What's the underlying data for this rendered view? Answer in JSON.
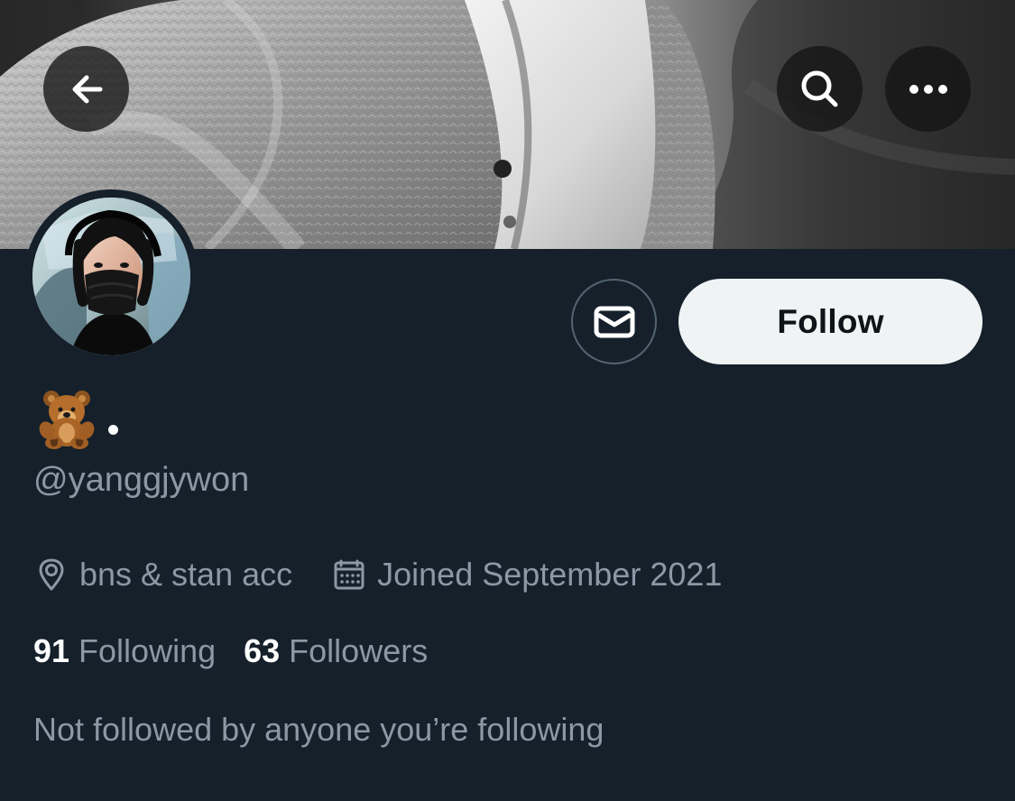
{
  "profile": {
    "display_name_suffix": "•",
    "username": "@yanggjywon",
    "location": "bns & stan acc",
    "joined": "Joined September 2021",
    "following_count": "91",
    "following_label": "Following",
    "followers_count": "63",
    "followers_label": "Followers",
    "mutual_followers_text": "Not followed by anyone you’re following"
  },
  "actions": {
    "follow_label": "Follow"
  },
  "icons": {
    "back": "arrow-left-icon",
    "search": "search-icon",
    "more": "more-horizontal-icon",
    "message": "envelope-icon",
    "display_name_emoji": "teddy-bear-icon",
    "location": "location-pin-icon",
    "joined": "calendar-icon"
  },
  "colors": {
    "background": "#15202b",
    "follow_button_background": "#eff3f4",
    "follow_button_text": "#0f1419",
    "primary_text": "#e7e9ea",
    "secondary_text": "#8b98a5",
    "outline": "#536471"
  }
}
